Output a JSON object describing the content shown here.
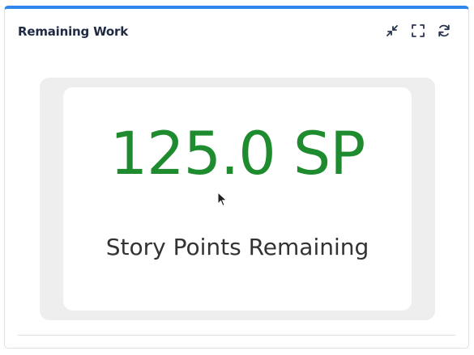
{
  "widget": {
    "title": "Remaining Work",
    "accent_color": "#2f86eb",
    "tools": [
      {
        "icon": "collapse-icon"
      },
      {
        "icon": "fullscreen-icon"
      },
      {
        "icon": "refresh-icon"
      }
    ]
  },
  "metric": {
    "value": "125.0 SP",
    "label": "Story Points Remaining",
    "value_color": "#1e8b2e"
  }
}
